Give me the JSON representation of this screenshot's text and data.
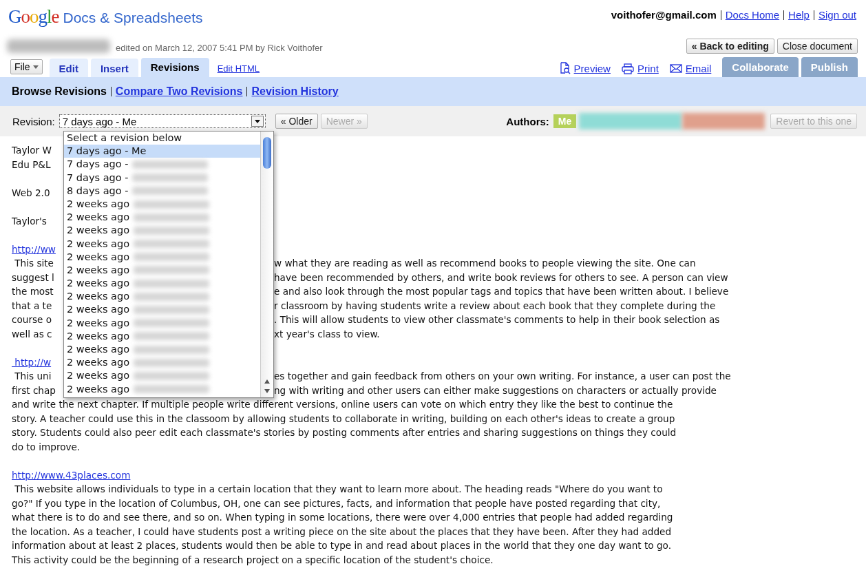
{
  "header": {
    "logo": "Google",
    "product": "Docs & Spreadsheets",
    "account": "voithofer@gmail.com",
    "links": [
      "Docs Home",
      "Help",
      "Sign out"
    ]
  },
  "document": {
    "edited": "edited on March 12, 2007 5:41 PM by Rick Voithofer",
    "buttons": [
      {
        "label": "« Back to editing",
        "bold": true
      },
      {
        "label": "Close document",
        "bold": false
      }
    ]
  },
  "toolbar": {
    "file_menu": "File",
    "tabs": [
      {
        "label": "Edit",
        "selected": false
      },
      {
        "label": "Insert",
        "selected": false
      },
      {
        "label": "Revisions",
        "selected": true
      }
    ],
    "edit_html": "Edit HTML",
    "actions": [
      {
        "label": "Preview",
        "kind": "preview"
      },
      {
        "label": "Print",
        "kind": "print"
      },
      {
        "label": "Email",
        "kind": "email"
      }
    ],
    "action_tabs": [
      "Collaborate",
      "Publish"
    ]
  },
  "subnav": {
    "current": "Browse Revisions",
    "links": [
      "Compare Two Revisions",
      "Revision History"
    ]
  },
  "revision_bar": {
    "label": "Revision:",
    "value": "7 days ago - Me",
    "buttons": [
      {
        "label": "« Older",
        "disabled": false
      },
      {
        "label": "Newer »",
        "disabled": true
      }
    ],
    "authors_label": "Authors:",
    "authors": [
      {
        "name": "Me",
        "color": "#b5d15a"
      },
      {
        "color": "#8fdcd6"
      },
      {
        "color": "#e0a08c"
      }
    ],
    "revert": {
      "label": "Revert to this one",
      "disabled": true
    }
  },
  "dropdown": [
    {
      "text": "Select a revision below",
      "selected": false,
      "blurred": false
    },
    {
      "text": "7 days ago - Me",
      "selected": true,
      "blurred": false
    },
    {
      "text": "7 days ago -",
      "selected": false,
      "blurred": true
    },
    {
      "text": "7 days ago -",
      "selected": false,
      "blurred": true
    },
    {
      "text": "8 days ago -",
      "selected": false,
      "blurred": true
    },
    {
      "text": "2 weeks ago",
      "selected": false,
      "blurred": true
    },
    {
      "text": "2 weeks ago",
      "selected": false,
      "blurred": true
    },
    {
      "text": "2 weeks ago",
      "selected": false,
      "blurred": true
    },
    {
      "text": "2 weeks ago",
      "selected": false,
      "blurred": true
    },
    {
      "text": "2 weeks ago",
      "selected": false,
      "blurred": true
    },
    {
      "text": "2 weeks ago",
      "selected": false,
      "blurred": true
    },
    {
      "text": "2 weeks ago",
      "selected": false,
      "blurred": true
    },
    {
      "text": "2 weeks ago",
      "selected": false,
      "blurred": true
    },
    {
      "text": "2 weeks ago",
      "selected": false,
      "blurred": true
    },
    {
      "text": "2 weeks ago",
      "selected": false,
      "blurred": true
    },
    {
      "text": "2 weeks ago",
      "selected": false,
      "blurred": true
    },
    {
      "text": "2 weeks ago",
      "selected": false,
      "blurred": true
    },
    {
      "text": "2 weeks ago",
      "selected": false,
      "blurred": true
    },
    {
      "text": "2 weeks ago",
      "selected": false,
      "blurred": true
    },
    {
      "text": "2 weeks ago",
      "selected": false,
      "blurred": true
    }
  ],
  "body": [
    {
      "kind": "split",
      "left": "Taylor W"
    },
    {
      "kind": "split",
      "left": "Edu P&L"
    },
    {
      "kind": "blank"
    },
    {
      "kind": "split",
      "left": "Web 2.0"
    },
    {
      "kind": "blank"
    },
    {
      "kind": "split",
      "left": "Taylor's"
    },
    {
      "kind": "blank"
    },
    {
      "kind": "link",
      "text": "http://ww"
    },
    {
      "kind": "split",
      "left": " This site",
      "right": "w what they are reading as well as recommend books to people viewing the site. One can"
    },
    {
      "kind": "split",
      "left": "suggest l",
      "right": "have been recommended by others, and write book reviews for others to see. A person can view"
    },
    {
      "kind": "split",
      "left": "the most",
      "right": "e and also look through the most popular tags and topics that have been written about. I believe"
    },
    {
      "kind": "split",
      "left": "that a te",
      "right": "r classroom by having students write a review about each book that they complete during the"
    },
    {
      "kind": "split",
      "left": "course o",
      "right": ". This will allow students to view other classmate's comments to help in their book selection as"
    },
    {
      "kind": "split",
      "left": "well as c",
      "right": "xt year's class to view."
    },
    {
      "kind": "blank"
    },
    {
      "kind": "link",
      "text": " http://w"
    },
    {
      "kind": "split",
      "left": " This uni",
      "right": "es together and gain feedback from others on your own writing. For instance, a user can post the"
    },
    {
      "kind": "split",
      "left": "first chap",
      "right": "ng with writing and other users can either make suggestions on characters or actually provide"
    },
    {
      "kind": "line",
      "text": "and write the next chapter. If multiple people write different versions, online users can vote on which entry they like the best to continue the"
    },
    {
      "kind": "line",
      "text": "story. A teacher could use this in the classoom by allowing students to collaborate in writing, building on each other's ideas to create a group"
    },
    {
      "kind": "line",
      "text": "story. Students could also peer edit each classmate's stories by posting comments after entries and sharing suggestions on things they could"
    },
    {
      "kind": "line",
      "text": "do to improve."
    },
    {
      "kind": "blank"
    },
    {
      "kind": "link",
      "text": "http://www.43places.com"
    },
    {
      "kind": "line",
      "text": " This website allows individuals to type in a certain location that they want to learn more about. The heading reads \"Where do you want to"
    },
    {
      "kind": "line",
      "text": "go?\" If you type in the location of Columbus, OH, one can see pictures, facts, and information that people have posted regarding that city,"
    },
    {
      "kind": "line",
      "text": "what there is to do and see there, and so on. When typing in some locations, there were over 4,000 entries that people had added regarding"
    },
    {
      "kind": "line",
      "text": "the location. As a teacher, I could have students post a writing piece on the site about the places that they have been. After they had added"
    },
    {
      "kind": "line",
      "text": "information about at least 2 places, students would then be able to type in and read about places in the world that they one day want to go."
    },
    {
      "kind": "line",
      "text": "This activity could be the beginning of a research project on a specific location of the student's choice."
    }
  ]
}
